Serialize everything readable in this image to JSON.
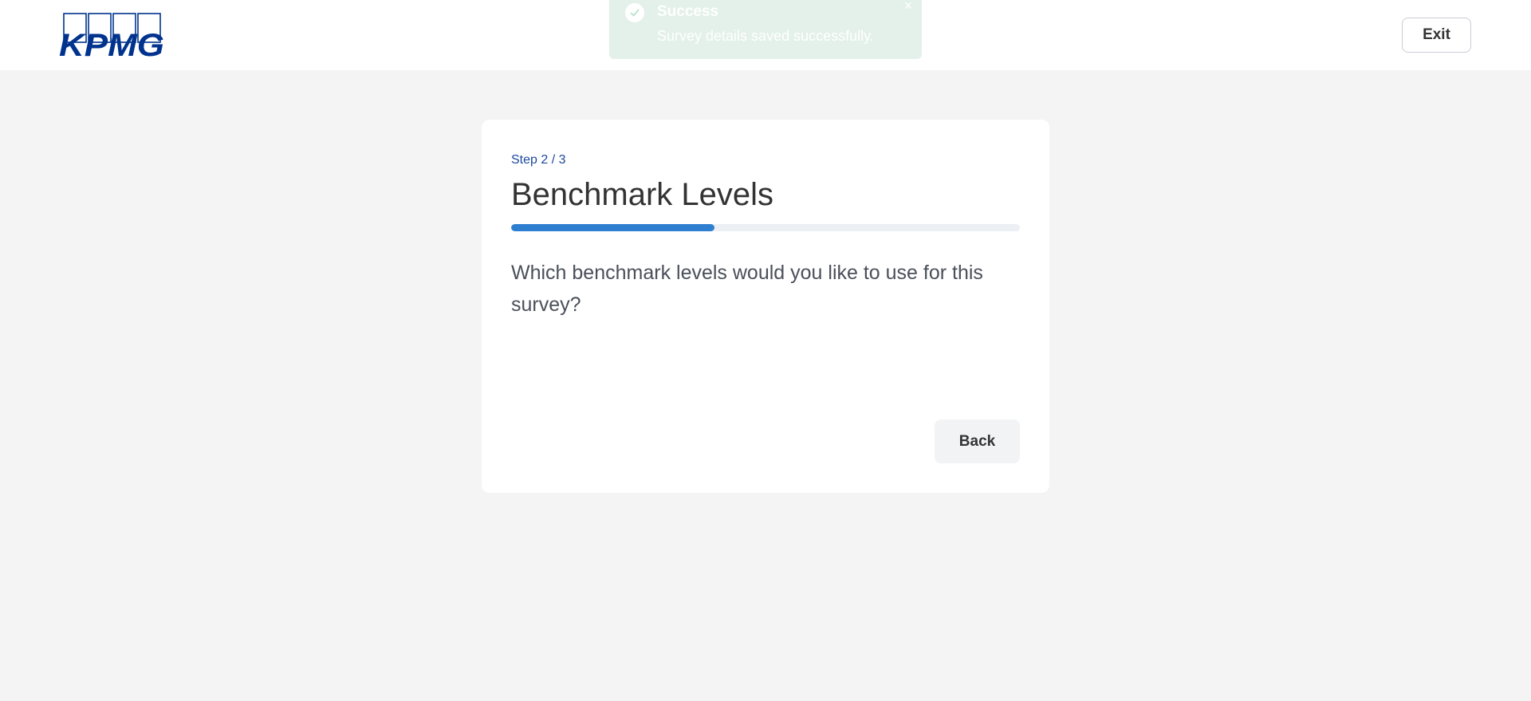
{
  "header": {
    "logo_text": "KPMG",
    "exit_label": "Exit"
  },
  "toast": {
    "title": "Success",
    "message": "Survey details saved successfully.",
    "icon": "check-circle-icon",
    "close_icon": "close-icon"
  },
  "card": {
    "step_label": "Step 2 / 3",
    "title": "Benchmark Levels",
    "progress_fraction": 0.4,
    "question": "Which benchmark levels would you like to use for this survey?",
    "back_label": "Back"
  },
  "colors": {
    "brand": "#00338d",
    "accent": "#2f7fd0",
    "toast_bg": "#e3f1ea",
    "page_bg": "#f4f4f4"
  }
}
